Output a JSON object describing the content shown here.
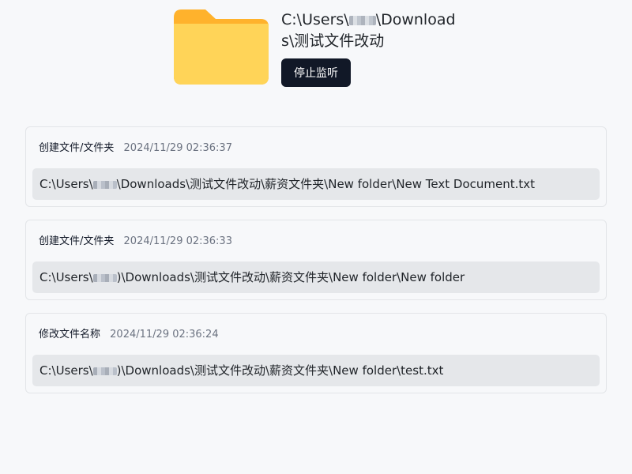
{
  "header": {
    "path_prefix": "C:\\Users\\",
    "path_suffix": "\\Downloads\\测试文件改动",
    "stop_button_label": "停止监听"
  },
  "colors": {
    "background": "#f7f8fa",
    "folder_body": "#ffd458",
    "folder_tab": "#ffb22c",
    "button_bg": "#111827",
    "path_bg": "#e5e7ea"
  },
  "logs": [
    {
      "action": "创建文件/文件夹",
      "time": "2024/11/29 02:36:37",
      "path_prefix": "C:\\Users\\",
      "path_suffix": "\\Downloads\\测试文件改动\\薪资文件夹\\New folder\\New Text Document.txt"
    },
    {
      "action": "创建文件/文件夹",
      "time": "2024/11/29 02:36:33",
      "path_prefix": "C:\\Users\\",
      "path_suffix": ")\\Downloads\\测试文件改动\\薪资文件夹\\New folder\\New folder"
    },
    {
      "action": "修改文件名称",
      "time": "2024/11/29 02:36:24",
      "path_prefix": "C:\\Users\\",
      "path_suffix": ")\\Downloads\\测试文件改动\\薪资文件夹\\New folder\\test.txt"
    }
  ]
}
